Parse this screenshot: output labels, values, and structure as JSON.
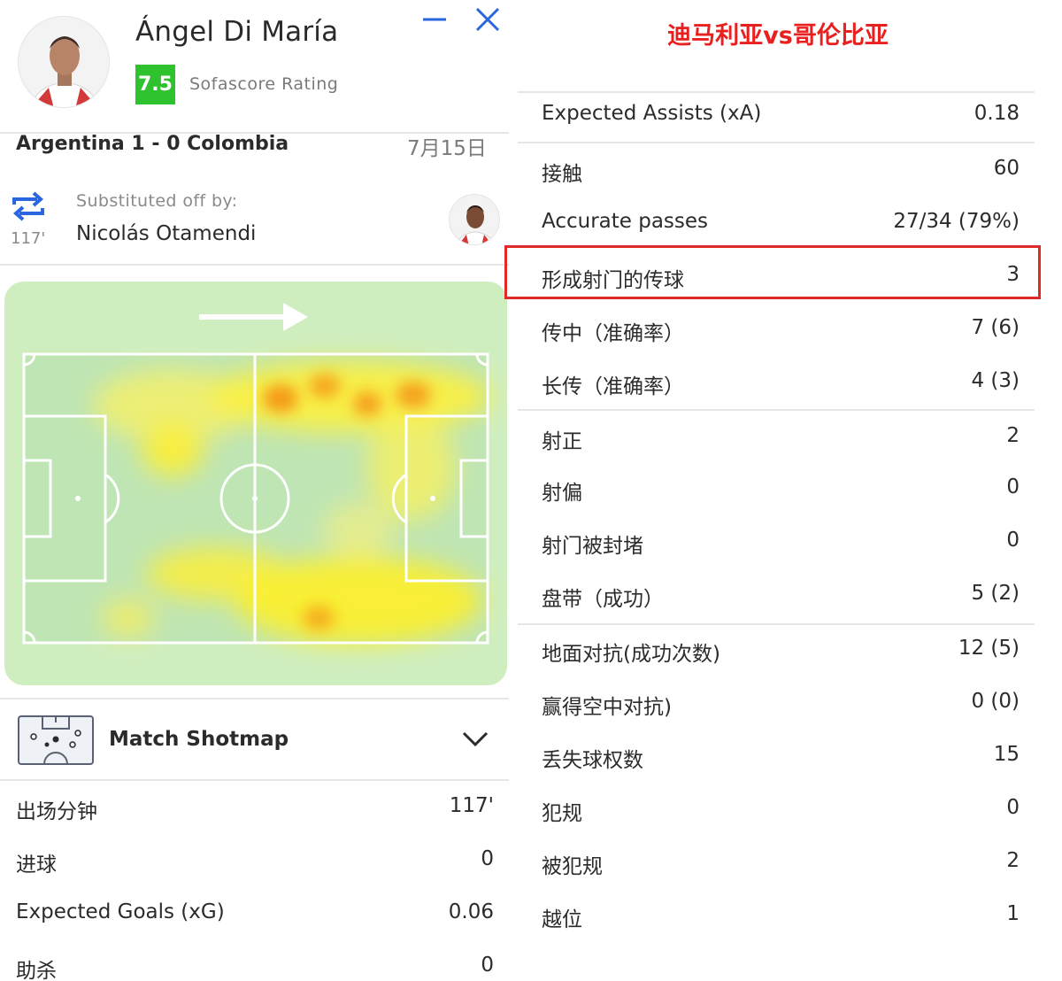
{
  "player": {
    "name": "Ángel Di María",
    "rating": "7.5",
    "rating_label": "Sofascore Rating"
  },
  "match": {
    "teams": "Argentina 1 - 0 Colombia",
    "date": "7月15日"
  },
  "substitution": {
    "label": "Substituted off by:",
    "player": "Nicolás Otamendi",
    "minute": "117'"
  },
  "shotmap": {
    "label": "Match Shotmap"
  },
  "left_stats": [
    {
      "label": "出场分钟",
      "value": "117'"
    },
    {
      "label": "进球",
      "value": "0"
    },
    {
      "label": "Expected Goals (xG)",
      "value": "0.06"
    },
    {
      "label": "助杀",
      "value": "0"
    }
  ],
  "right_panel": {
    "headline": "迪马利亚vs哥伦比亚",
    "stats": [
      {
        "label": "Expected Assists (xA)",
        "value": "0.18"
      },
      {
        "label": "接触",
        "value": "60"
      },
      {
        "label": "Accurate passes",
        "value": "27/34 (79%)"
      },
      {
        "label": "形成射门的传球",
        "value": "3",
        "highlighted": true
      },
      {
        "label": "传中（准确率）",
        "value": "7 (6)"
      },
      {
        "label": "长传（准确率）",
        "value": "4 (3)"
      },
      {
        "label": "射正",
        "value": "2"
      },
      {
        "label": "射偏",
        "value": "0"
      },
      {
        "label": "射门被封堵",
        "value": "0"
      },
      {
        "label": "盘带（成功）",
        "value": "5 (2)"
      },
      {
        "label": "地面对抗(成功次数)",
        "value": "12 (5)"
      },
      {
        "label": "赢得空中对抗)",
        "value": "0 (0)"
      },
      {
        "label": "丢失球权数",
        "value": "15"
      },
      {
        "label": "犯规",
        "value": "0"
      },
      {
        "label": "被犯规",
        "value": "2"
      },
      {
        "label": "越位",
        "value": "1"
      }
    ]
  },
  "colors": {
    "rating_green": "#2ec22e",
    "accent_blue": "#2a66e0",
    "highlight_red": "#e02a2a",
    "headline_red": "#e8201f",
    "pitch_green": "#cfeec0"
  },
  "icons": {
    "minimize": "minus-icon",
    "close": "close-x-icon",
    "substitution": "swap-arrows-icon",
    "shotmap": "mini-pitch-icon",
    "expand": "chevron-down-icon"
  }
}
